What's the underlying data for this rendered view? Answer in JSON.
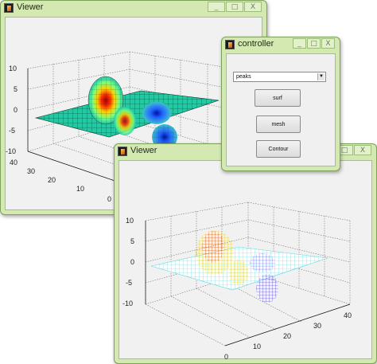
{
  "windows": {
    "viewer_back": {
      "title": "Viewer"
    },
    "viewer_front": {
      "title": "Viewer"
    },
    "controller": {
      "title": "controller"
    }
  },
  "window_buttons": {
    "minimize": "_",
    "maximize": "□",
    "close": "X"
  },
  "controller": {
    "select_value": "peaks",
    "surf_label": "surf",
    "mesh_label": "mesh",
    "contour_label": "Contour"
  },
  "axes": {
    "z_ticks": [
      "10",
      "5",
      "0",
      "-5",
      "-10"
    ],
    "x_ticks": [
      "40",
      "30",
      "20",
      "10",
      "0"
    ],
    "y_ticks": [
      "0",
      "10",
      "20",
      "30",
      "40"
    ]
  },
  "colors": {
    "window_frame": "#d4e9b2",
    "axes_background": "#f1f1f1",
    "surf_colormap": "jet"
  }
}
